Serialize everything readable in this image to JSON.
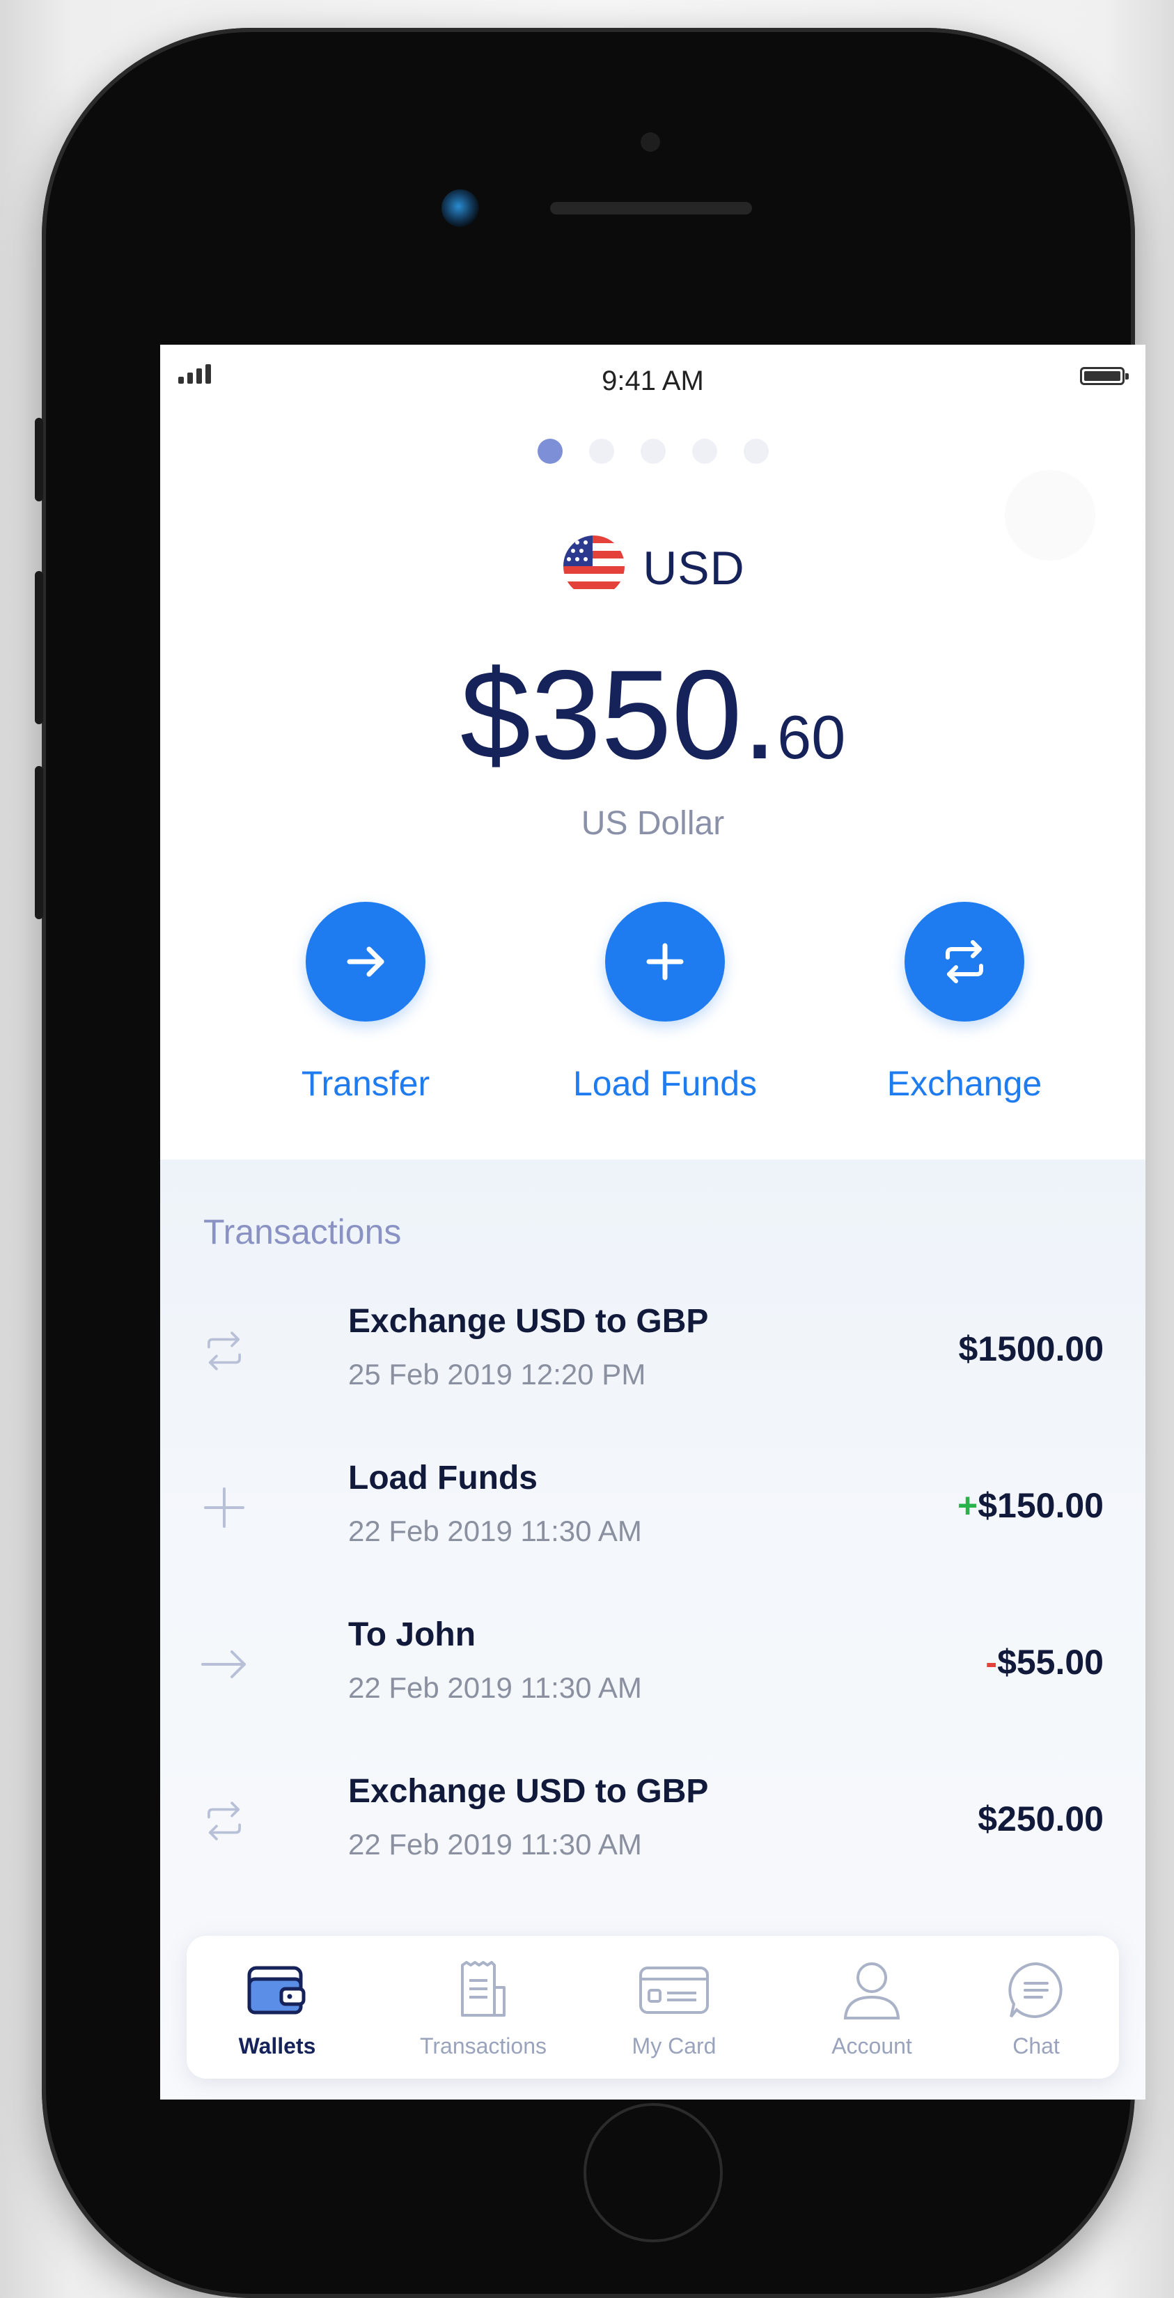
{
  "status_bar": {
    "time": "9:41 AM"
  },
  "pager": {
    "count": 5,
    "active": 0
  },
  "wallet": {
    "currency_code": "USD",
    "balance_main": "$350.",
    "balance_cents": "60",
    "currency_name": "US Dollar"
  },
  "actions": [
    {
      "label": "Transfer",
      "icon": "arrow-right-icon"
    },
    {
      "label": "Load Funds",
      "icon": "plus-icon"
    },
    {
      "label": "Exchange",
      "icon": "swap-icon"
    }
  ],
  "transactions": {
    "title": "Transactions",
    "items": [
      {
        "name": "Exchange USD to GBP",
        "date": "25 Feb 2019  12:20 PM",
        "sign": "",
        "amount": "$1500.00",
        "icon": "swap-icon"
      },
      {
        "name": "Load Funds",
        "date": "22 Feb 2019  11:30 AM",
        "sign": "+",
        "amount": "$150.00",
        "icon": "plus-icon"
      },
      {
        "name": "To John",
        "date": "22 Feb 2019  11:30 AM",
        "sign": "-",
        "amount": "$55.00",
        "icon": "arrow-right-icon"
      },
      {
        "name": "Exchange USD to GBP",
        "date": "22 Feb 2019  11:30 AM",
        "sign": "",
        "amount": "$250.00",
        "icon": "swap-icon"
      }
    ]
  },
  "tabbar": {
    "items": [
      {
        "label": "Wallets",
        "icon": "wallet-icon",
        "active": true
      },
      {
        "label": "Transactions",
        "icon": "receipt-icon",
        "active": false
      },
      {
        "label": "My Card",
        "icon": "card-icon",
        "active": false
      },
      {
        "label": "Account",
        "icon": "user-icon",
        "active": false
      },
      {
        "label": "Chat",
        "icon": "chat-icon",
        "active": false
      }
    ]
  },
  "colors": {
    "accent": "#1f7cf0",
    "navy": "#16225a",
    "positive": "#28b34b",
    "negative": "#e5413b",
    "muted": "#8a90a8"
  }
}
